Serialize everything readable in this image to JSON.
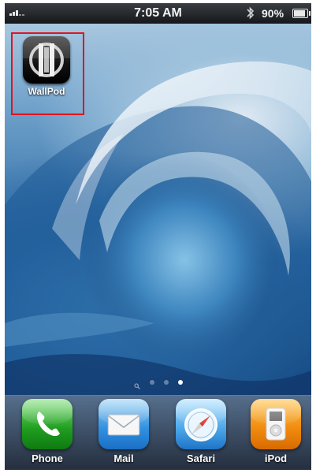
{
  "status_bar": {
    "time": "7:05 AM",
    "battery_percent": "90%",
    "battery_level": 0.9,
    "icons": [
      "signal-bars-icon",
      "bluetooth-icon",
      "battery-icon"
    ]
  },
  "home_screen": {
    "apps": [
      {
        "label": "WallPod",
        "icon": "wallpod-app-icon",
        "highlighted": true
      }
    ],
    "page_indicator": {
      "pages": 3,
      "current": 3,
      "has_search_page": true
    }
  },
  "dock": {
    "apps": [
      {
        "label": "Phone",
        "icon": "phone-icon"
      },
      {
        "label": "Mail",
        "icon": "mail-icon"
      },
      {
        "label": "Safari",
        "icon": "safari-icon"
      },
      {
        "label": "iPod",
        "icon": "ipod-icon"
      }
    ]
  },
  "colors": {
    "highlight_border": "#e0141e",
    "phone": "#1f9d1f",
    "mail": "#2f8fe0",
    "safari": "#4aa6e8",
    "ipod": "#f08a0e"
  }
}
